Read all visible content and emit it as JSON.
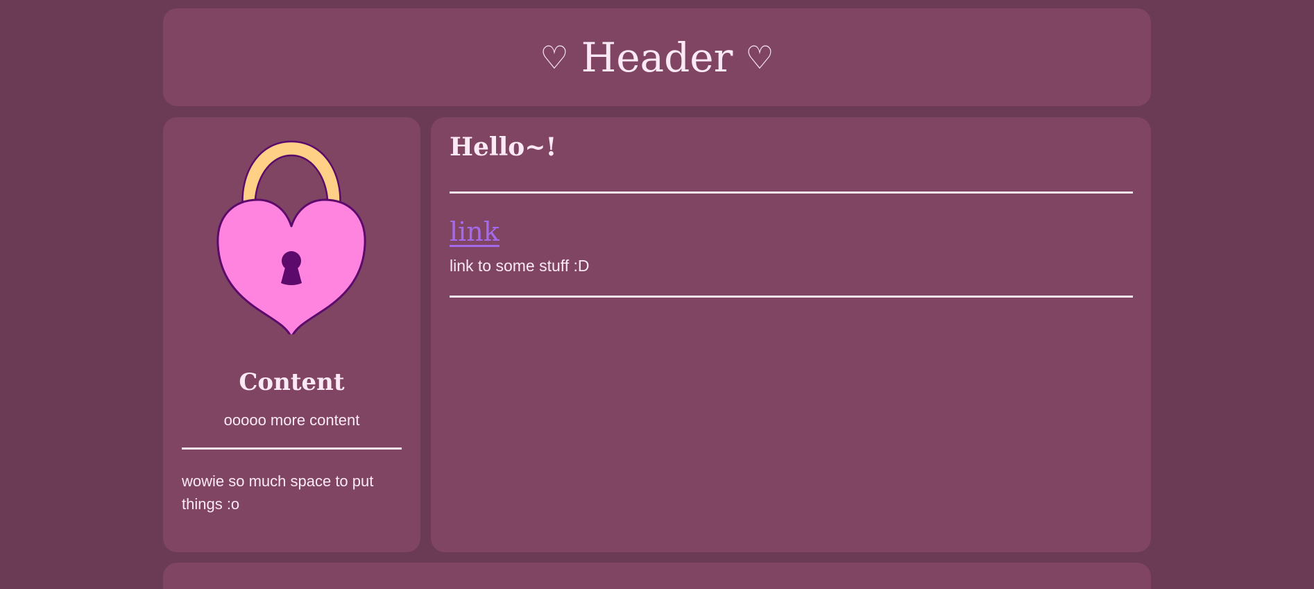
{
  "header": {
    "title": "Header",
    "left_icon": "heart-outline-icon",
    "right_icon": "heart-outline-icon"
  },
  "sidebar": {
    "image": "heart-padlock-icon",
    "title": "Content",
    "subtitle": "ooooo more content",
    "body": "wowie so much space to put things :o"
  },
  "main": {
    "heading": "Hello~!",
    "link_label": "link",
    "link_description": "link to some stuff :D"
  },
  "colors": {
    "background": "#6b3a55",
    "panel": "#804562",
    "text": "#fbe9f5",
    "link": "#a36bec",
    "heart": "#ff84df",
    "shackle": "#ffd085",
    "outline": "#5c0a6b"
  }
}
